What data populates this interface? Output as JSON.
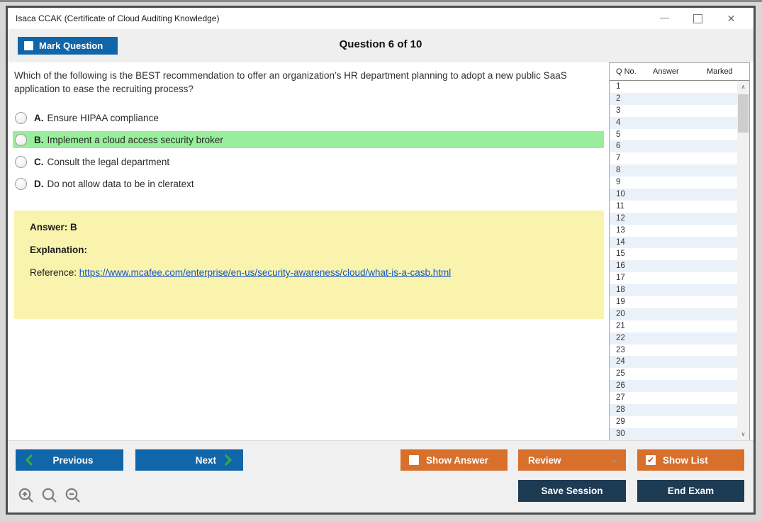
{
  "window": {
    "title": "Isaca CCAK (Certificate of Cloud Auditing Knowledge)"
  },
  "icons": {
    "minimize": "—",
    "close": "✕",
    "check": "✔",
    "scroll_up": "∧",
    "scroll_down": "∨",
    "review_caret": "▲"
  },
  "header": {
    "mark_question_label": "Mark Question",
    "title": "Question 6 of 10"
  },
  "question": {
    "text": "Which of the following is the BEST recommendation to offer an organization’s HR department planning to adopt a new public SaaS application to ease the recruiting process?",
    "options": [
      {
        "letter": "A.",
        "text": "Ensure HIPAA compliance",
        "highlighted": false
      },
      {
        "letter": "B.",
        "text": "Implement a cloud access security broker",
        "highlighted": true
      },
      {
        "letter": "C.",
        "text": "Consult the legal department",
        "highlighted": false
      },
      {
        "letter": "D.",
        "text": "Do not allow data to be in cleratext",
        "highlighted": false
      }
    ]
  },
  "explanation": {
    "answer_label": "Answer: B",
    "explanation_label": "Explanation:",
    "reference_label": "Reference: ",
    "reference_url": "https://www.mcafee.com/enterprise/en-us/security-awareness/cloud/what-is-a-casb.html"
  },
  "sidebar": {
    "columns": [
      "Q No.",
      "Answer",
      "Marked"
    ],
    "row_numbers": [
      "1",
      "2",
      "3",
      "4",
      "5",
      "6",
      "7",
      "8",
      "9",
      "10",
      "11",
      "12",
      "13",
      "14",
      "15",
      "16",
      "17",
      "18",
      "19",
      "20",
      "21",
      "22",
      "23",
      "24",
      "25",
      "26",
      "27",
      "28",
      "29",
      "30"
    ]
  },
  "footer": {
    "previous_label": "Previous",
    "next_label": "Next",
    "show_answer_label": "Show Answer",
    "review_label": "Review",
    "show_list_label": "Show List",
    "save_session_label": "Save Session",
    "end_exam_label": "End Exam",
    "show_answer_checked": false,
    "show_list_checked": true
  },
  "colors": {
    "accent_blue": "#1166A9",
    "accent_orange": "#D8702B",
    "dark_navy": "#1E3B54",
    "highlight_green": "#98EE9B",
    "explanation_yellow": "#FAF3AD",
    "chevron_green": "#2FAE3F",
    "link_blue": "#1155CC",
    "alt_row_blue": "#EAF1F9"
  }
}
